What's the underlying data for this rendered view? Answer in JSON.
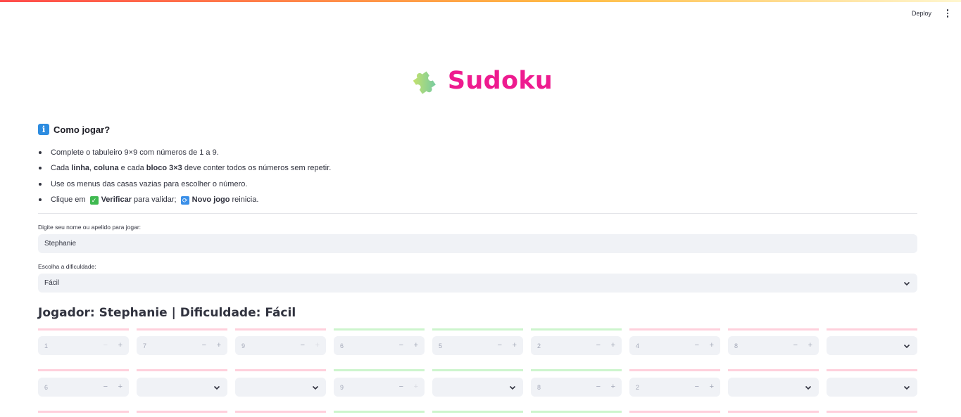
{
  "header": {
    "deploy_label": "Deploy"
  },
  "title": {
    "icon": "puzzle-piece-icon",
    "text": "Sudoku",
    "color": "#ee1b8f"
  },
  "how_to": {
    "title": "Como jogar?",
    "rule1": "Complete o tabuleiro 9×9 com números de 1 a 9.",
    "rule2_a": "Cada ",
    "rule2_b": "linha",
    "rule2_c": ", ",
    "rule2_d": "coluna",
    "rule2_e": " e cada ",
    "rule2_f": "bloco 3×3",
    "rule2_g": " deve conter todos os números sem repetir.",
    "rule3": "Use os menus das casas vazias para escolher o número.",
    "rule4_a": "Clique em ",
    "rule4_b": "Verificar",
    "rule4_c": " para validar; ",
    "rule4_d": "Novo jogo",
    "rule4_e": " reinicia."
  },
  "name_field": {
    "label": "Digite seu nome ou apelido para jogar:",
    "value": "Stephanie"
  },
  "difficulty": {
    "label": "Escolha a dificuldade:",
    "value": "Fácil"
  },
  "player_line": "Jogador: Stephanie | Dificuldade: Fácil",
  "board": {
    "row1": {
      "c1": "1",
      "c2": "7",
      "c3": "9",
      "c4": "6",
      "c5": "5",
      "c6": "2",
      "c7": "4",
      "c8": "8",
      "c9": ""
    },
    "row2": {
      "c1": "6",
      "c2": "",
      "c3": "",
      "c4": "9",
      "c5": "",
      "c6": "8",
      "c7": "2",
      "c8": "",
      "c9": ""
    },
    "minus_symbol": "−",
    "plus_symbol": "+"
  },
  "colors": {
    "separator_pink": "#ffd0dc",
    "separator_green": "#cdf5cd",
    "input_bg": "#f0f2f6"
  }
}
